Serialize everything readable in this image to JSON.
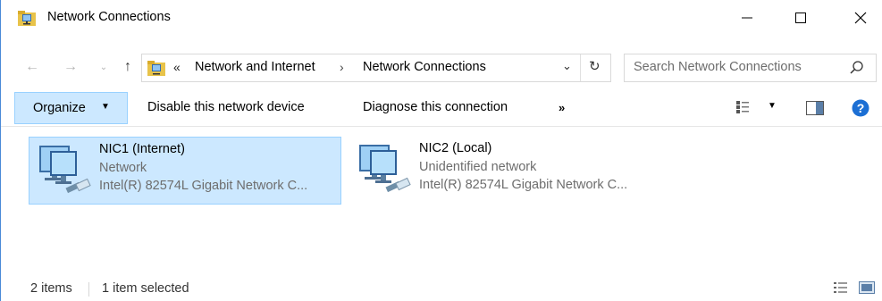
{
  "window": {
    "title": "Network Connections",
    "buttons": {
      "minimize": "—",
      "maximize": "☐",
      "close": "✕"
    }
  },
  "nav": {
    "back": "←",
    "forward": "→",
    "recent": "⌄",
    "up": "↑"
  },
  "address": {
    "chevron": "«",
    "crumbs": [
      "Network and Internet",
      "Network Connections"
    ],
    "separator": "›",
    "dropdown": "⌄",
    "refresh": "↻"
  },
  "search": {
    "placeholder": "Search Network Connections"
  },
  "commandbar": {
    "organize": "Organize",
    "organize_caret": "▼",
    "disable": "Disable this network device",
    "diagnose": "Diagnose this connection",
    "more": "»",
    "view_caret": "▼"
  },
  "items": [
    {
      "name": "NIC1 (Internet)",
      "network": "Network",
      "device": "Intel(R) 82574L Gigabit Network C...",
      "selected": true
    },
    {
      "name": "NIC2 (Local)",
      "network": "Unidentified network",
      "device": "Intel(R) 82574L Gigabit Network C...",
      "selected": false
    }
  ],
  "status": {
    "count": "2 items",
    "selected": "1 item selected"
  },
  "colors": {
    "selection_bg": "#cce8ff",
    "selection_border": "#99d1ff",
    "help_blue": "#1c6fd4",
    "window_border": "#4a8ad8"
  }
}
